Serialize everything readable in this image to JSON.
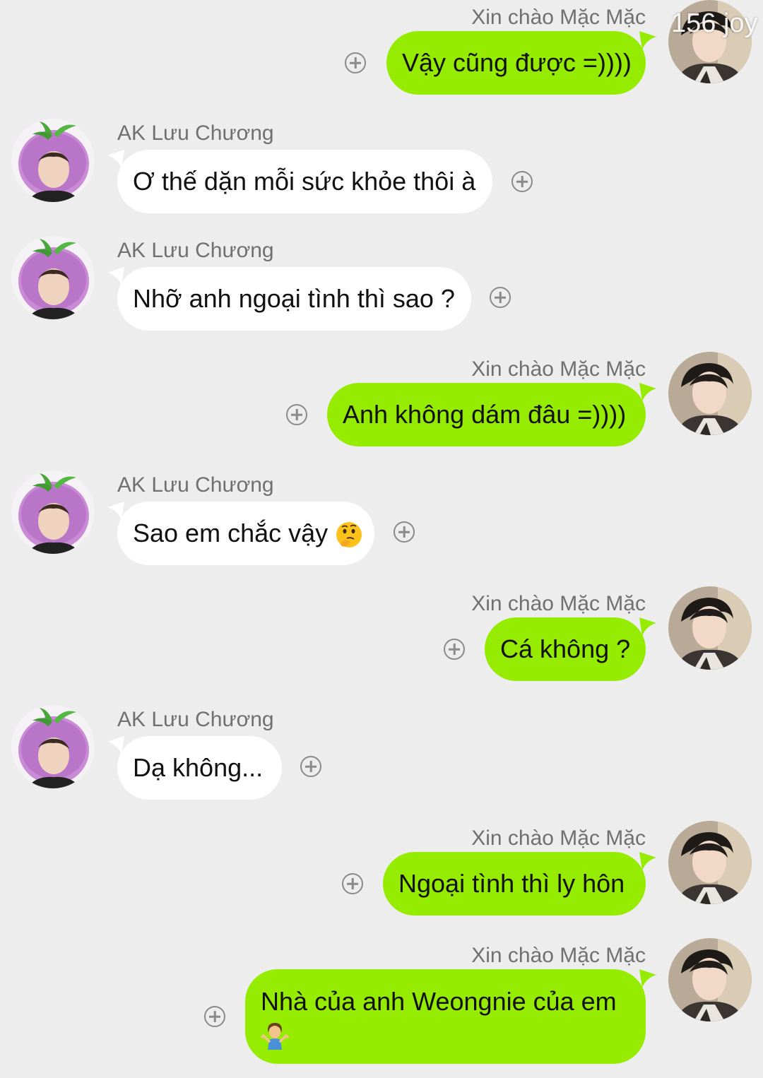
{
  "watermark": "156 joy",
  "chat": {
    "self_name": "Xin chào Mặc Mặc",
    "other_name": "AK Lưu Chương",
    "colors": {
      "outgoing_bubble": "#95ec00",
      "incoming_bubble": "#ffffff",
      "background": "#ededed"
    },
    "messages": [
      {
        "direction": "out",
        "sender": "Xin chào Mặc Mặc",
        "text": "Vậy cũng được =))))"
      },
      {
        "direction": "in",
        "sender": "AK Lưu Chương",
        "text": "Ơ thế dặn mỗi sức khỏe thôi à"
      },
      {
        "direction": "in",
        "sender": "AK Lưu Chương",
        "text": "Nhỡ anh ngoại tình thì sao ?"
      },
      {
        "direction": "out",
        "sender": "Xin chào Mặc Mặc",
        "text": "Anh không dám đâu =))))"
      },
      {
        "direction": "in",
        "sender": "AK Lưu Chương",
        "text": "Sao em chắc vậy",
        "emoji": "thinking-face"
      },
      {
        "direction": "out",
        "sender": "Xin chào Mặc Mặc",
        "text": "Cá không ?"
      },
      {
        "direction": "in",
        "sender": "AK Lưu Chương",
        "text": "Dạ không..."
      },
      {
        "direction": "out",
        "sender": "Xin chào Mặc Mặc",
        "text": "Ngoại tình thì ly hôn"
      },
      {
        "direction": "out",
        "sender": "Xin chào Mặc Mặc",
        "text": "Nhà của anh Weongnie của em",
        "emoji": "person-shrugging"
      }
    ]
  }
}
